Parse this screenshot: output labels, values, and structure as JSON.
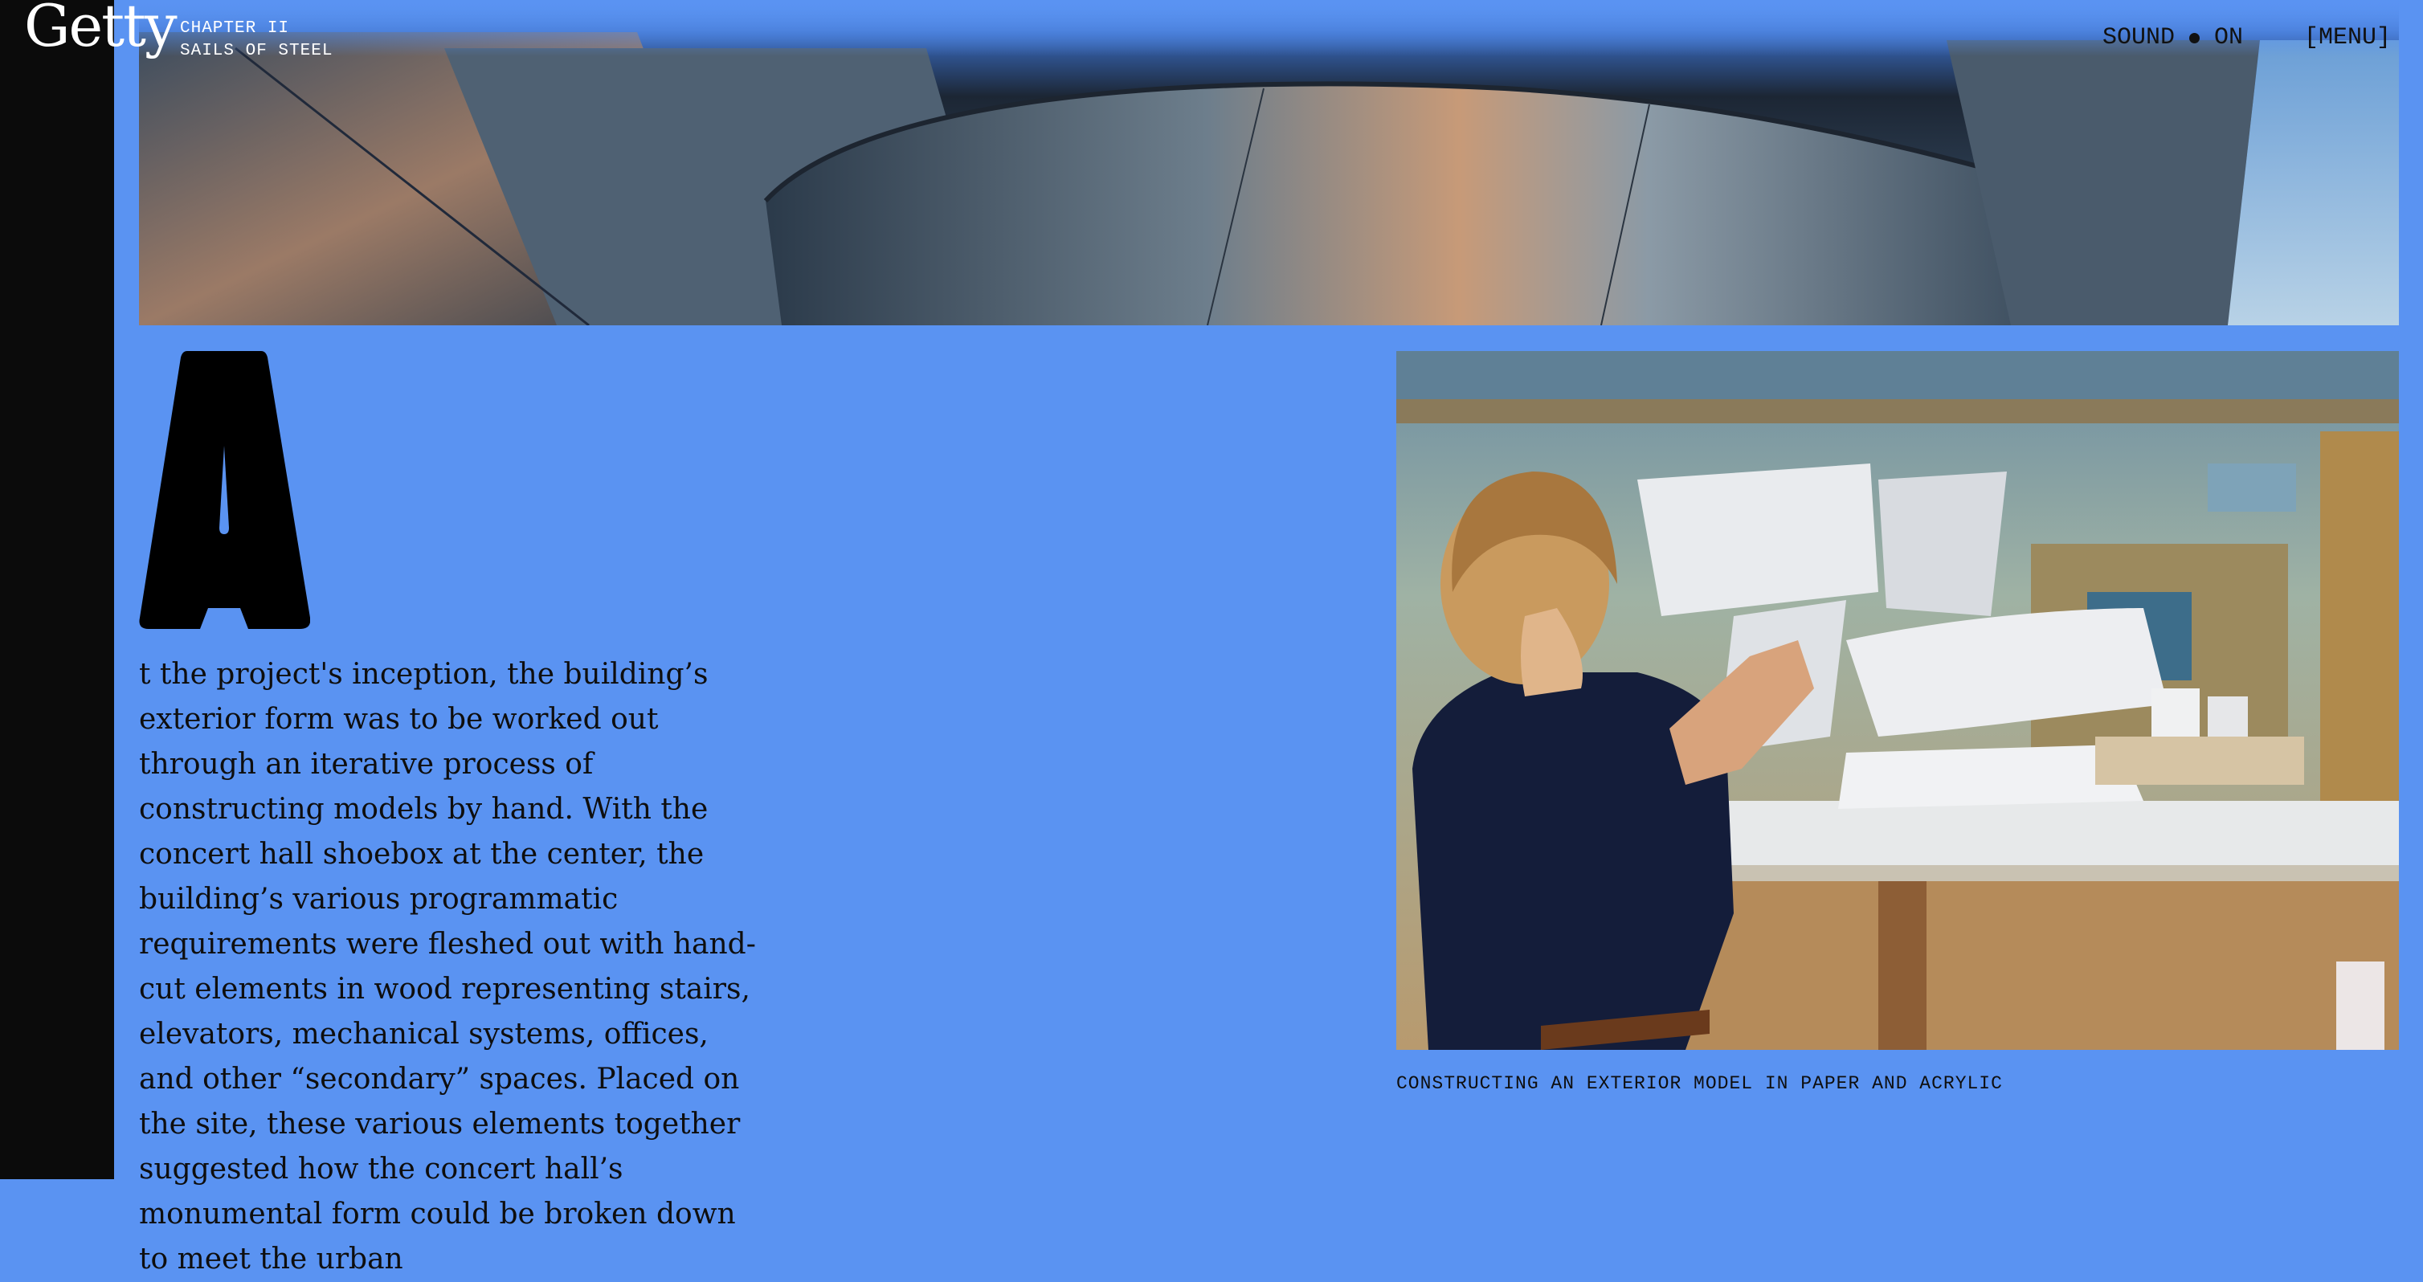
{
  "header": {
    "logo": "Getty",
    "chapter_number": "CHAPTER II",
    "chapter_title": "SAILS OF STEEL",
    "sound_label": "SOUND",
    "sound_state": "ON",
    "menu_label": "[MENU]"
  },
  "article": {
    "drop_cap": "A",
    "body": "t the project's inception, the building’s exterior form was to be worked out through an iterative process of constructing models by hand. With the concert hall shoebox at the center, the building’s various programmatic requirements were fleshed out with hand-cut elements in wood representing stairs, elevators, mechanical systems, offices, and other “secondary” spaces. Placed on the site, these various elements together suggested how the concert hall’s monumental form could be broken down to meet the urban"
  },
  "figure": {
    "caption": "CONSTRUCTING AN EXTERIOR MODEL IN PAPER AND ACRYLIC"
  },
  "colors": {
    "background": "#5a93f2",
    "left_strip": "#0b0b0b",
    "text": "#0e0e0e"
  }
}
